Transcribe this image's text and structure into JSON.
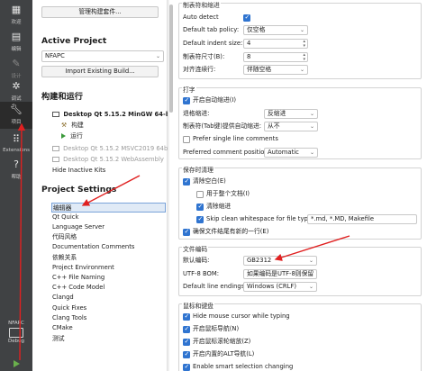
{
  "activity_bar": {
    "items": [
      {
        "label": "欢迎",
        "icon": "grid-icon"
      },
      {
        "label": "编辑",
        "icon": "document-icon"
      },
      {
        "label": "设计",
        "icon": "pencil-icon"
      },
      {
        "label": "调试",
        "icon": "bug-icon"
      },
      {
        "label": "项目",
        "icon": "wrench-icon"
      },
      {
        "label": "Extensions",
        "icon": "extensions-icon"
      },
      {
        "label": "帮助",
        "icon": "help-icon"
      }
    ],
    "kit_name": "NFAPC",
    "kit_mode": "Debug"
  },
  "project_panel": {
    "manage_kits_label": "管理构建套件...",
    "active_project_heading": "Active Project",
    "active_project_value": "NFAPC",
    "import_build_label": "Import Existing Build...",
    "build_run_heading": "构建和运行",
    "kit_active": "Desktop Qt 5.15.2 MinGW 64-bit",
    "kit_build": "构建",
    "kit_run": "运行",
    "kit_inactive_1": "Desktop Qt 5.15.2 MSVC2019 64bit",
    "kit_inactive_2": "Desktop Qt 5.15.2 WebAssembly",
    "hide_inactive": "Hide Inactive Kits",
    "project_settings_heading": "Project Settings",
    "settings_items": [
      "编辑器",
      "Qt Quick",
      "Language Server",
      "代码风格",
      "Documentation Comments",
      "依赖关系",
      "Project Environment",
      "C++ File Naming",
      "C++ Code Model",
      "Clangd",
      "Quick Fixes",
      "Clang Tools",
      "CMake",
      "测试"
    ]
  },
  "settings": {
    "tabs_indent_title": "制表符和缩进",
    "auto_detect": "Auto detect",
    "tab_policy_label": "Default tab policy:",
    "tab_policy_value": "仅空格",
    "indent_size_label": "Default indent size:",
    "indent_size_value": "4",
    "tab_size_label": "制表符尺寸(B):",
    "tab_size_value": "8",
    "align_cont_label": "对齐连续行:",
    "align_cont_value": "伴随空格",
    "typing_title": "打字",
    "auto_indent": "开启自动缩进(I)",
    "backspace_label": "退格缩进:",
    "backspace_value": "反缩进",
    "tab_key_label": "制表符(Tab键)提供自动缩进:",
    "tab_key_value": "从不",
    "prefer_single_line": "Prefer single line comments",
    "comment_pos_label": "Preferred comment position:",
    "comment_pos_value": "Automatic",
    "save_cleanup_title": "保存时清理",
    "clean_whitespace": "清除空白(E)",
    "modified_only": "用于整个文档(I)",
    "clean_indent": "清除缩进",
    "skip_clean": "Skip clean whitespace for file types:",
    "skip_types": "*.md, *.MD, Makefile",
    "ensure_newline": "确保文件结尾有新的一行(E)",
    "encoding_title": "文件编码",
    "default_encoding_label": "默认编码:",
    "default_encoding_value": "GB2312",
    "bom_label": "UTF-8 BOM:",
    "bom_value": "如果编码是UTF-8则保留",
    "line_endings_label": "Default line endings:",
    "line_endings_value": "Windows (CRLF)",
    "mouse_keyboard_title": "鼠标和键盘",
    "hide_cursor": "Hide mouse cursor while typing",
    "enable_scroll_wheel": "开启鼠标导航(N)",
    "scroll_zoom": "开启鼠标滚轮缩放(Z)",
    "alt_zoom": "开启内置的ALT导航(L)",
    "smart_select": "Enable smart selection changing"
  }
}
